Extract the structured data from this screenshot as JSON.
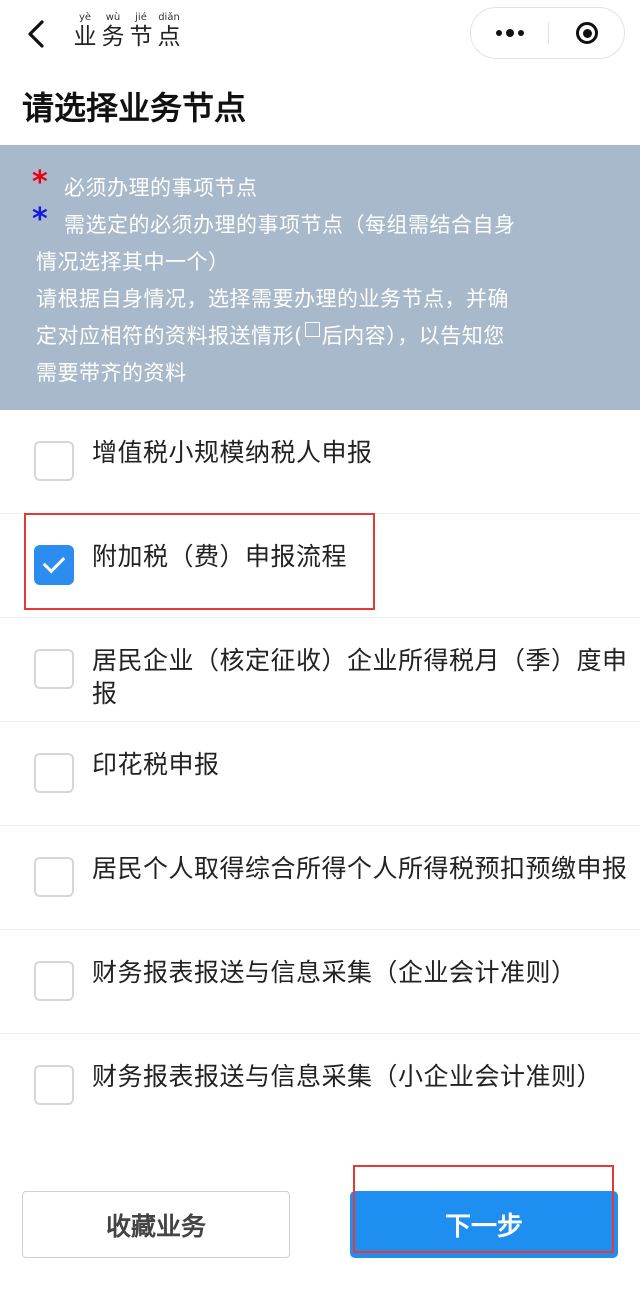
{
  "nav": {
    "title_chars": [
      {
        "py": "yè",
        "hz": "业"
      },
      {
        "py": "wù",
        "hz": "务"
      },
      {
        "py": "jié",
        "hz": "节"
      },
      {
        "py": "diǎn",
        "hz": "点"
      }
    ]
  },
  "page_title": "请选择业务节点",
  "notice": {
    "required_mark": "*",
    "required_text": "必须办理的事项节点",
    "optional_mark": "*",
    "optional_text_1": "需选定的必须办理的事项节点（每组需结合自身",
    "optional_text_2": "情况选择其中一个）",
    "instruction_1": "请根据自身情况，选择需要办理的业务节点，并确",
    "instruction_2a": "定对应相符的资料报送情形(",
    "instruction_2b": "后内容），以告知您",
    "instruction_3": "需要带齐的资料",
    "colors": {
      "required_star": "#e60012",
      "optional_star": "#1a1adb",
      "background": "#a9b9cc"
    }
  },
  "items": [
    {
      "label": "增值税小规模纳税人申报",
      "checked": false
    },
    {
      "label": "附加税（费）申报流程",
      "checked": true
    },
    {
      "label": "居民企业（核定征收）企业所得税月（季）度申报",
      "checked": false
    },
    {
      "label": "印花税申报",
      "checked": false
    },
    {
      "label": "居民个人取得综合所得个人所得税预扣预缴申报",
      "checked": false
    },
    {
      "label": "财务报表报送与信息采集（企业会计准则）",
      "checked": false
    },
    {
      "label": "财务报表报送与信息采集（小企业会计准则）",
      "checked": false
    }
  ],
  "buttons": {
    "favorite": "收藏业务",
    "next": "下一步"
  },
  "accent_color": "#1e8ff0"
}
